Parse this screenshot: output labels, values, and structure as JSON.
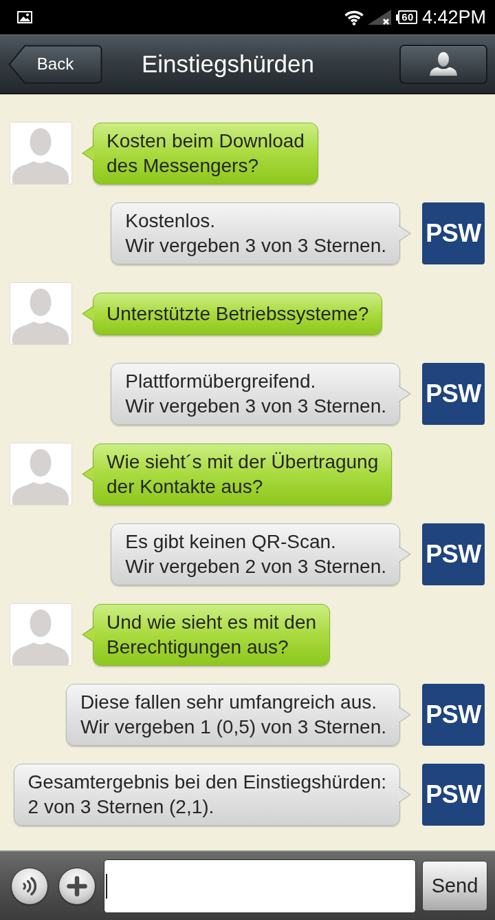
{
  "status_bar": {
    "battery": "60",
    "time": "4:42PM"
  },
  "header": {
    "back_label": "Back",
    "title": "Einstiegshürden"
  },
  "messages": [
    {
      "kind": "incoming",
      "text": "Kosten beim Download\ndes Messengers?"
    },
    {
      "kind": "outgoing",
      "text": "Kostenlos.\nWir vergeben 3 von 3 Sternen.",
      "logo": "PSW"
    },
    {
      "kind": "incoming",
      "text": "Unterstützte Betriebssysteme?"
    },
    {
      "kind": "outgoing",
      "text": "Plattformübergreifend.\nWir vergeben 3 von 3 Sternen.",
      "logo": "PSW"
    },
    {
      "kind": "incoming",
      "text": "Wie sieht´s mit der Übertragung\nder Kontakte aus?"
    },
    {
      "kind": "outgoing",
      "text": "Es gibt keinen QR-Scan.\nWir vergeben 2 von 3 Sternen.",
      "logo": "PSW"
    },
    {
      "kind": "incoming",
      "text": "Und wie sieht es mit den\nBerechtigungen aus?"
    },
    {
      "kind": "outgoing",
      "text": "Diese fallen sehr umfangreich aus.\nWir vergeben 1 (0,5) von 3 Sternen.",
      "logo": "PSW"
    },
    {
      "kind": "outgoing",
      "text": "Gesamtergebnis bei den Einstiegshürden:\n2 von 3 Sternen (2,1).",
      "logo": "PSW"
    }
  ],
  "composer": {
    "send_label": "Send"
  }
}
